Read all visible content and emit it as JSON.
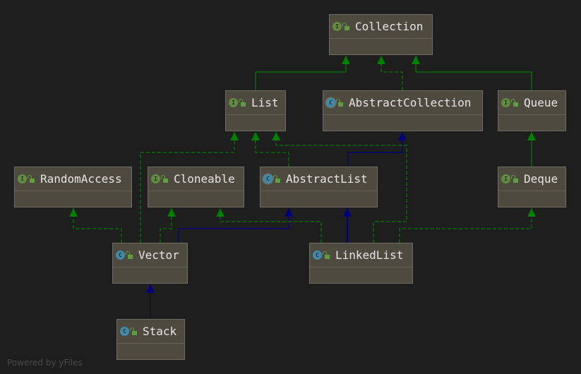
{
  "nodes": {
    "collection": {
      "name": "Collection",
      "kind": "interface"
    },
    "list": {
      "name": "List",
      "kind": "interface"
    },
    "abstract_collection": {
      "name": "AbstractCollection",
      "kind": "abstract-class"
    },
    "queue": {
      "name": "Queue",
      "kind": "interface"
    },
    "random_access": {
      "name": "RandomAccess",
      "kind": "interface"
    },
    "cloneable": {
      "name": "Cloneable",
      "kind": "interface"
    },
    "abstract_list": {
      "name": "AbstractList",
      "kind": "abstract-class"
    },
    "deque": {
      "name": "Deque",
      "kind": "interface"
    },
    "vector": {
      "name": "Vector",
      "kind": "class"
    },
    "linked_list": {
      "name": "LinkedList",
      "kind": "class"
    },
    "stack": {
      "name": "Stack",
      "kind": "class"
    }
  },
  "badges": {
    "interface": "I",
    "class": "C"
  },
  "colors": {
    "implements": "#008000",
    "extends_class": "#00008b",
    "extends_interface": "#008000",
    "background": "#1e1e1e",
    "node": "#4e4a3f"
  },
  "footer": "Powered by yFiles"
}
